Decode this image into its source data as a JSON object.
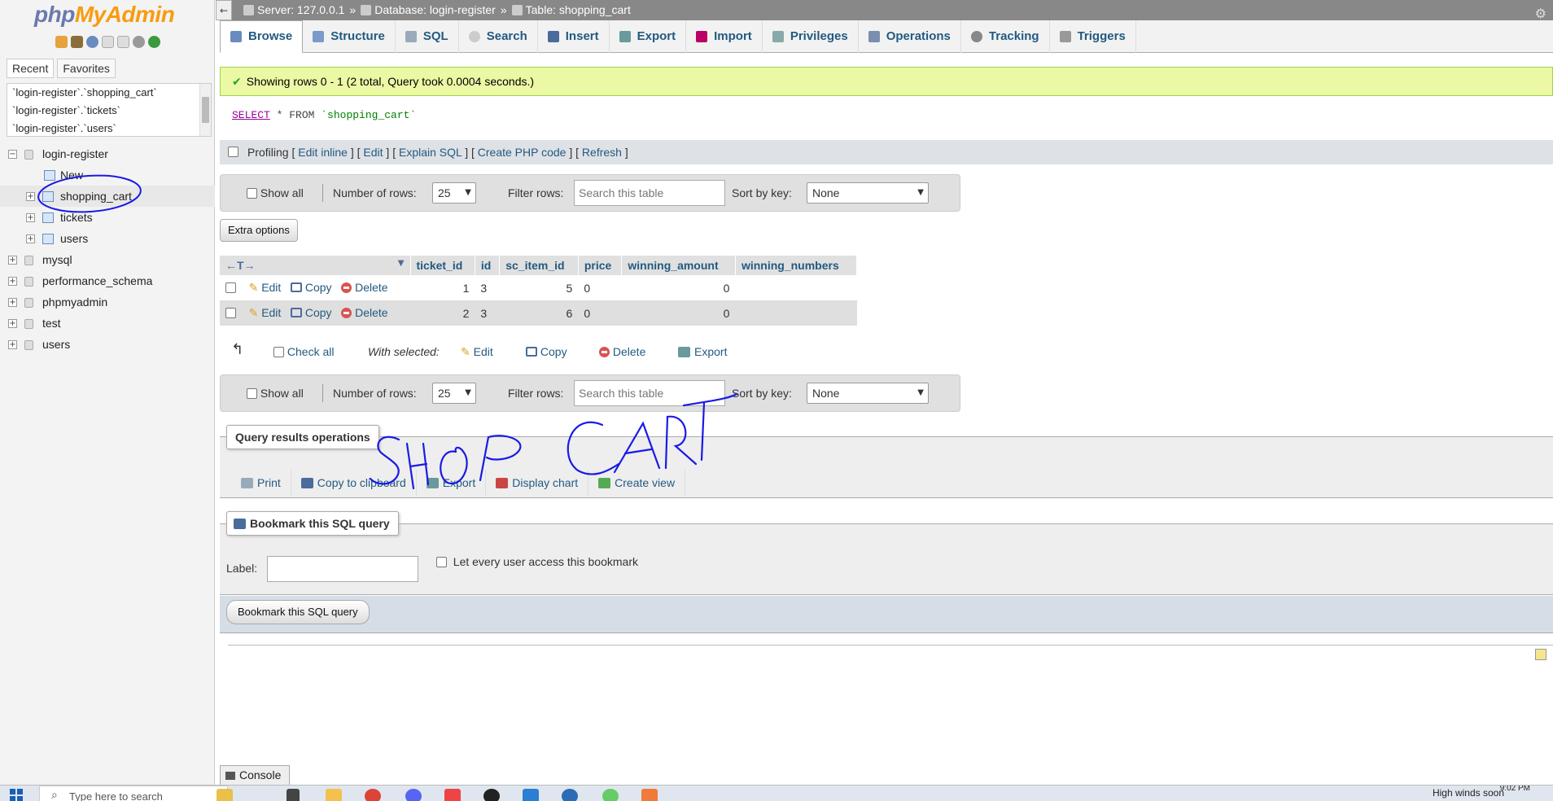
{
  "sidebar": {
    "logo_php": "php",
    "logo_myadmin": "MyAdmin",
    "tabs": [
      "Recent",
      "Favorites"
    ],
    "recent": [
      "`login-register`.`shopping_cart`",
      "`login-register`.`tickets`",
      "`login-register`.`users`"
    ],
    "tree": {
      "db_login": "login-register",
      "new": "New",
      "shopping_cart": "shopping_cart",
      "tickets": "tickets",
      "users_tbl": "users",
      "mysql": "mysql",
      "performance_schema": "performance_schema",
      "phpmyadmin": "phpmyadmin",
      "test": "test",
      "users_db": "users"
    }
  },
  "header": {
    "collapse": "←",
    "server": "Server: 127.0.0.1",
    "database": "Database: login-register",
    "table": "Table: shopping_cart",
    "sep": "»"
  },
  "tabs": [
    "Browse",
    "Structure",
    "SQL",
    "Search",
    "Insert",
    "Export",
    "Import",
    "Privileges",
    "Operations",
    "Tracking",
    "Triggers"
  ],
  "message": "Showing rows 0 - 1 (2 total, Query took 0.0004 seconds.)",
  "sql": {
    "select": "SELECT",
    "rest": " * FROM ",
    "table": "`shopping_cart`"
  },
  "profiling": {
    "label": "Profiling",
    "edit_inline": "Edit inline",
    "edit": "Edit",
    "explain": "Explain SQL",
    "php": "Create PHP code",
    "refresh": "Refresh"
  },
  "nav": {
    "show_all": "Show all",
    "num_rows_label": "Number of rows:",
    "num_rows": "25",
    "filter_label": "Filter rows:",
    "filter_placeholder": "Search this table",
    "sort_label": "Sort by key:",
    "sort_value": "None"
  },
  "extra_options": "Extra options",
  "grid": {
    "arrows": "←T→",
    "columns": [
      "ticket_id",
      "id",
      "sc_item_id",
      "price",
      "winning_amount",
      "winning_numbers"
    ],
    "actions": {
      "edit": "Edit",
      "copy": "Copy",
      "delete": "Delete"
    },
    "rows": [
      [
        "1",
        "3",
        "5",
        "0",
        "0",
        ""
      ],
      [
        "2",
        "3",
        "6",
        "0",
        "0",
        ""
      ]
    ]
  },
  "with_selected": {
    "check_all": "Check all",
    "label": "With selected:",
    "edit": "Edit",
    "copy": "Copy",
    "delete": "Delete",
    "export": "Export"
  },
  "query_ops": {
    "legend": "Query results operations",
    "print": "Print",
    "copy": "Copy to clipboard",
    "export": "Export",
    "chart": "Display chart",
    "view": "Create view"
  },
  "bookmark": {
    "legend": "Bookmark this SQL query",
    "label": "Label:",
    "every_user": "Let every user access this bookmark",
    "button": "Bookmark this SQL query"
  },
  "console": "Console",
  "taskbar": {
    "search_placeholder": "Type here to search",
    "weather": "High winds soon",
    "time": "9:02 PM"
  },
  "colors": {
    "link": "#235a81",
    "success_bg": "#ebf8a4",
    "scribble": "#1a1ae6"
  }
}
